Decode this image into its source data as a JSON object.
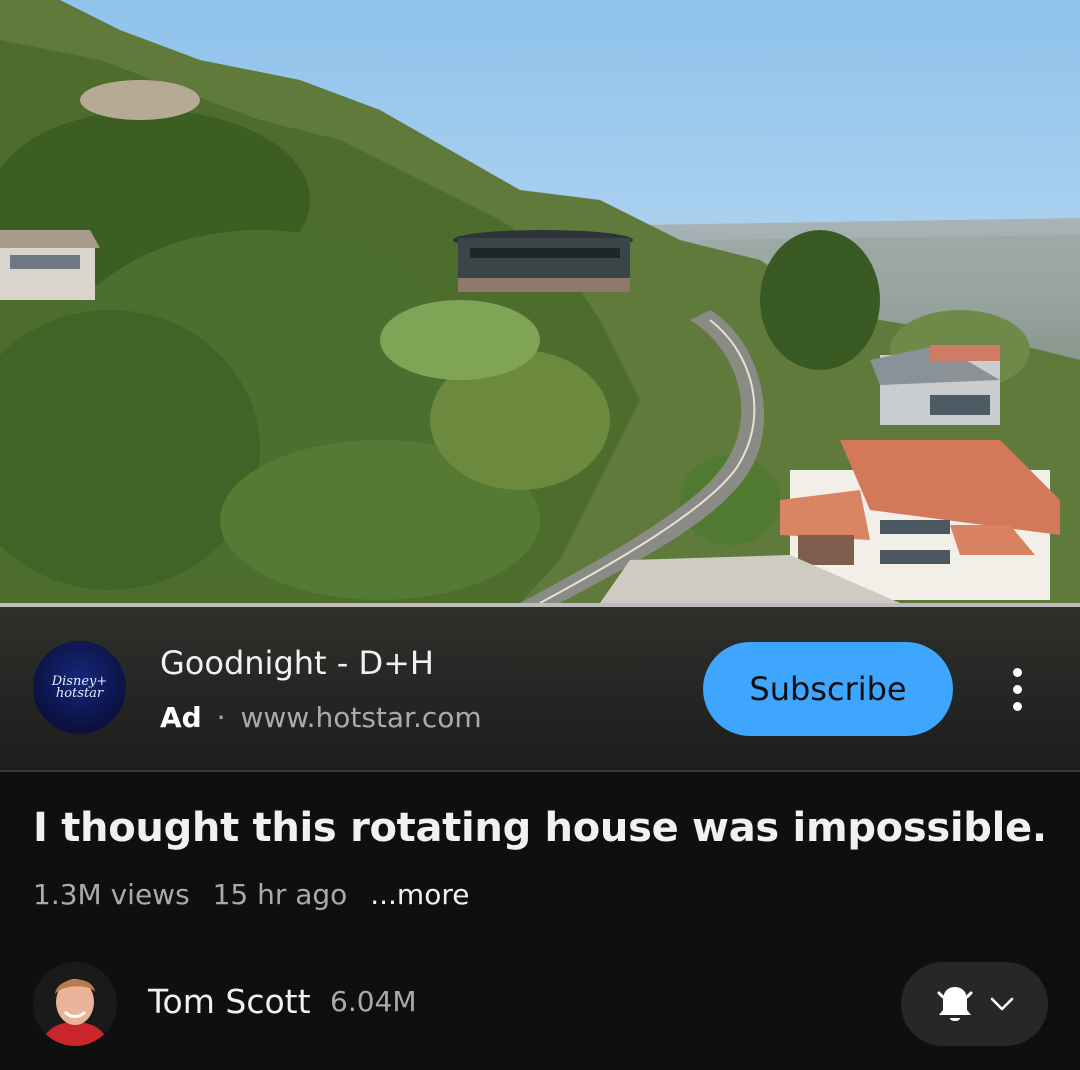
{
  "ad": {
    "advertiser_logo_text": "Disney+ hotstar",
    "title": "Goodnight - D+H",
    "label": "Ad",
    "separator": "·",
    "url": "www.hotstar.com",
    "subscribe_label": "Subscribe"
  },
  "video": {
    "title": "I thought this rotating house was impossible.",
    "views": "1.3M views",
    "age": "15 hr ago",
    "more_label": "...more"
  },
  "channel": {
    "name": "Tom Scott",
    "subscribers": "6.04M"
  },
  "icons": {
    "kebab": "more-vert-icon",
    "bell": "notifications-bell-icon",
    "chevron": "chevron-down-icon"
  },
  "colors": {
    "subscribe_bg": "#3ea6ff",
    "background": "#0f0f0f",
    "secondary_text": "#aaaaaa"
  }
}
